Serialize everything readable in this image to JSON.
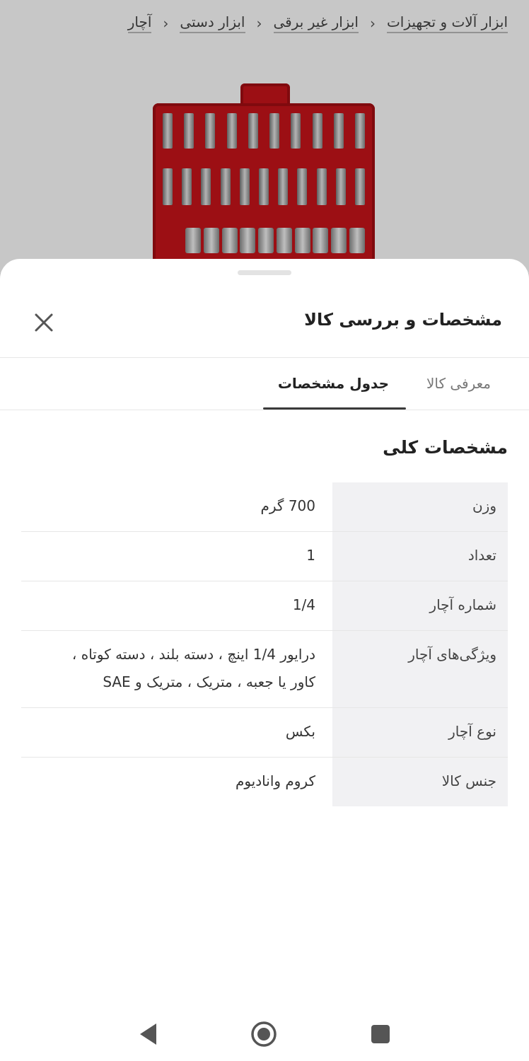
{
  "breadcrumb": {
    "items": [
      "ابزار آلات و تجهیزات",
      "ابزار غیر برقی",
      "ابزار دستی",
      "آچار"
    ],
    "separator": "›"
  },
  "sheet": {
    "title": "مشخصات و بررسی کالا",
    "close_icon": "close-icon"
  },
  "tabs": [
    {
      "label": "معرفی کالا",
      "active": false
    },
    {
      "label": "جدول مشخصات",
      "active": true
    }
  ],
  "section": {
    "title": "مشخصات کلی"
  },
  "specs": [
    {
      "key": "وزن",
      "value": "700 گرم"
    },
    {
      "key": "تعداد",
      "value": "1"
    },
    {
      "key": "شماره آچار",
      "value": "1/4"
    },
    {
      "key": "ویژگی‌های آچار",
      "value": "درایور 1/4 اینچ ، دسته بلند ، دسته کوتاه ، کاور یا جعبه ، متریک ، متریک و SAE"
    },
    {
      "key": "نوع آچار",
      "value": "بکس"
    },
    {
      "key": "جنس کالا",
      "value": "کروم وانادیوم"
    }
  ],
  "nav": {
    "back_icon": "back-triangle-icon",
    "home_icon": "home-circle-icon",
    "recents_icon": "recents-square-icon"
  },
  "colors": {
    "case_red": "#c8141a",
    "active_tab_underline": "#3a3a3a",
    "key_cell_bg": "#f1f1f3"
  }
}
